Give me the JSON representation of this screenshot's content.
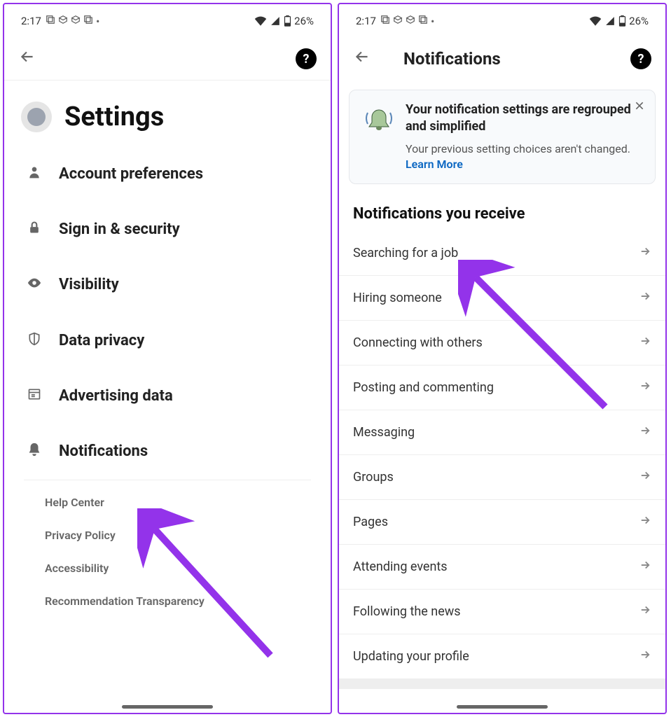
{
  "status": {
    "time": "2:17",
    "battery": "26%"
  },
  "left": {
    "title": "Settings",
    "items": [
      {
        "icon": "person",
        "label": "Account preferences"
      },
      {
        "icon": "lock",
        "label": "Sign in & security"
      },
      {
        "icon": "eye",
        "label": "Visibility"
      },
      {
        "icon": "shield",
        "label": "Data privacy"
      },
      {
        "icon": "newspaper",
        "label": "Advertising data"
      },
      {
        "icon": "bell",
        "label": "Notifications"
      }
    ],
    "footer": [
      "Help Center",
      "Privacy Policy",
      "Accessibility",
      "Recommendation Transparency"
    ]
  },
  "right": {
    "header": "Notifications",
    "infoTitle": "Your notification settings are regrouped and simplified",
    "infoSub": "Your previous setting choices aren't changed. ",
    "learnMore": "Learn More",
    "sectionTitle": "Notifications you receive",
    "items": [
      "Searching for a job",
      "Hiring someone",
      "Connecting with others",
      "Posting and commenting",
      "Messaging",
      "Groups",
      "Pages",
      "Attending events",
      "Following the news",
      "Updating your profile"
    ]
  }
}
